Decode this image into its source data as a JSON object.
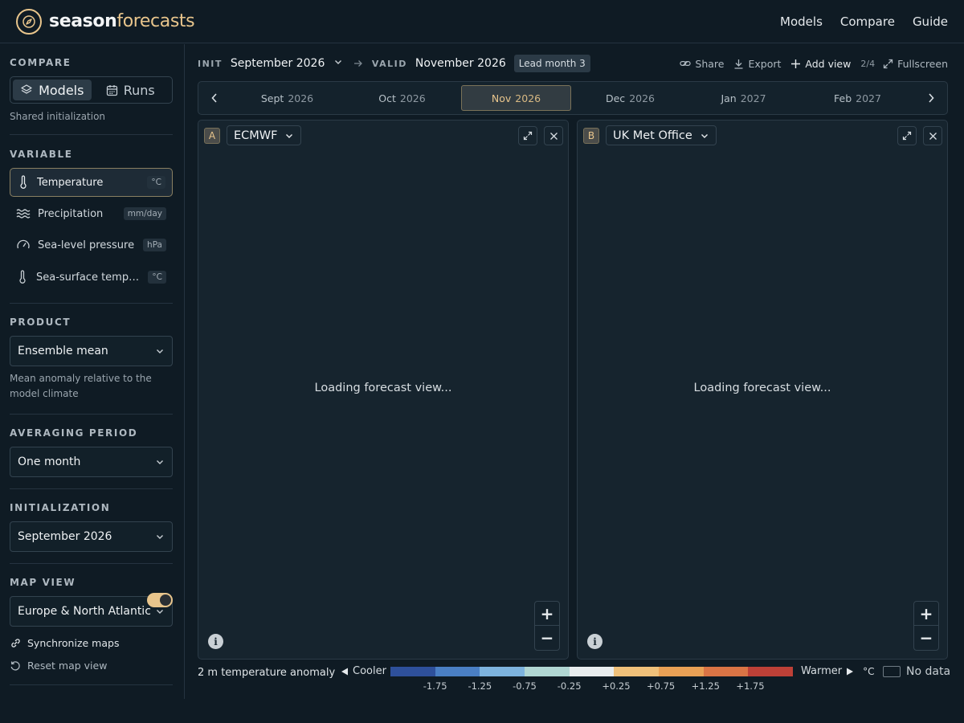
{
  "brand": {
    "name_a": "season",
    "name_b": "forecasts",
    "accent": "#e8c58c"
  },
  "nav": [
    "Models",
    "Compare",
    "Guide"
  ],
  "sidebar": {
    "compare": {
      "title": "COMPARE",
      "models_label": "Models",
      "runs_label": "Runs",
      "note": "Shared initialization"
    },
    "variable": {
      "title": "VARIABLE",
      "items": [
        {
          "label": "Temperature",
          "unit": "°C",
          "icon": "thermometer-icon"
        },
        {
          "label": "Precipitation",
          "unit": "mm/day",
          "icon": "waves-icon"
        },
        {
          "label": "Sea-level pressure",
          "unit": "hPa",
          "icon": "gauge-icon"
        },
        {
          "label": "Sea-surface temper...",
          "unit": "°C",
          "icon": "thermometer-icon"
        }
      ]
    },
    "product": {
      "title": "PRODUCT",
      "value": "Ensemble mean",
      "note": "Mean anomaly relative to the model climate"
    },
    "averaging": {
      "title": "AVERAGING PERIOD",
      "value": "One month"
    },
    "initialization": {
      "title": "INITIALIZATION",
      "value": "September 2026"
    },
    "map_view": {
      "title": "MAP VIEW",
      "value": "Europe & North Atlantic",
      "sync_label": "Synchronize maps",
      "sync_on": true,
      "reset_label": "Reset map view"
    }
  },
  "topbar": {
    "init_label": "INIT",
    "init_value": "September 2026",
    "valid_label": "VALID",
    "valid_value": "November 2026",
    "lead": "Lead month 3",
    "share": "Share",
    "export": "Export",
    "add_view": "Add view",
    "count": "2/4",
    "fullscreen": "Fullscreen"
  },
  "timeline": {
    "months": [
      {
        "m": "Sept",
        "y": "2026"
      },
      {
        "m": "Oct",
        "y": "2026"
      },
      {
        "m": "Nov",
        "y": "2026"
      },
      {
        "m": "Dec",
        "y": "2026"
      },
      {
        "m": "Jan",
        "y": "2027"
      },
      {
        "m": "Feb",
        "y": "2027"
      }
    ],
    "active_index": 2
  },
  "panels": [
    {
      "badge": "A",
      "model": "ECMWF",
      "loading": "Loading forecast view..."
    },
    {
      "badge": "B",
      "model": "UK Met Office",
      "loading": "Loading forecast view..."
    }
  ],
  "legend": {
    "title": "2 m temperature anomaly",
    "cooler": "Cooler",
    "warmer": "Warmer",
    "unit": "°C",
    "no_data": "No data",
    "colors": [
      "#2e509b",
      "#4a7fc4",
      "#7db3de",
      "#b0d6d3",
      "#e8ecee",
      "#efc07a",
      "#e9a055",
      "#da7445",
      "#bd4037"
    ],
    "ticks": [
      "-1.75",
      "-1.25",
      "-0.75",
      "-0.25",
      "+0.25",
      "+0.75",
      "+1.25",
      "+1.75"
    ]
  }
}
